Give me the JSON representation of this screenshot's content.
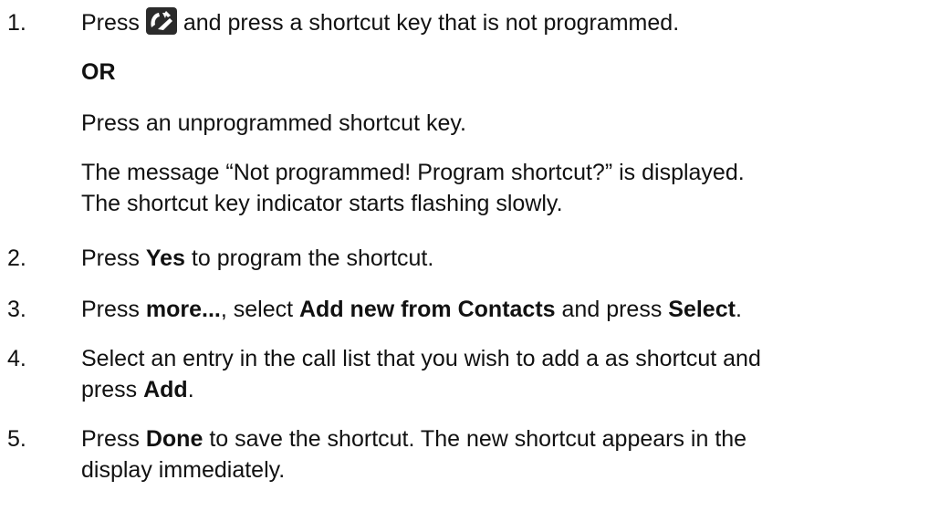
{
  "steps": [
    {
      "number": "1.",
      "text_before_icon": "Press",
      "icon": "speed-dial-hand-icon",
      "text_after_icon": "and press a shortcut key that is not programmed.",
      "or_label": "OR",
      "alt_text": "Press an unprogrammed shortcut key.",
      "message_line1": "The message “Not programmed! Program shortcut?” is displayed.",
      "message_line2": "The shortcut key indicator starts flashing slowly."
    },
    {
      "number": "2.",
      "pre": "Press",
      "bold": "Yes",
      "post": "to program the shortcut."
    },
    {
      "number": "3.",
      "pre": "Press",
      "bold1": "more...",
      "mid": ", select",
      "bold2": "Add new from Contacts",
      "mid2": "and press",
      "bold3": "Select",
      "post": "."
    },
    {
      "number": "4.",
      "line1": "Select an entry in the call list that you wish to add a as shortcut and",
      "pre": "press",
      "bold": "Add",
      "post": "."
    },
    {
      "number": "5.",
      "pre": "Press",
      "bold": "Done",
      "line1_post": "to save the shortcut. The new shortcut appears in the",
      "line2": "display immediately."
    }
  ],
  "colors": {
    "text": "#111111",
    "icon_fill": "#2b2b2b"
  }
}
